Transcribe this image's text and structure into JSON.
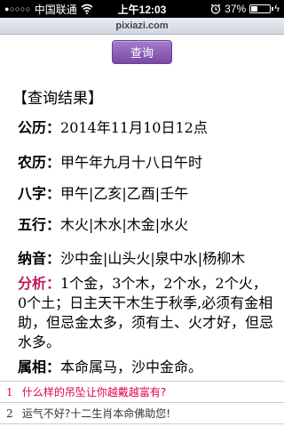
{
  "status_bar": {
    "signal": "●○○○○",
    "carrier": "中国联通",
    "time": "上午12:03",
    "battery_percent": 37,
    "battery_label": "37%"
  },
  "url_bar": {
    "domain": "pixiazi.com"
  },
  "query_button": {
    "label": "查询"
  },
  "results": {
    "header": "【查询结果】",
    "gongli": {
      "label": "公历：",
      "value": "2014年11月10日12点"
    },
    "nongli": {
      "label": "农历：",
      "value": "甲午年九月十八日午时"
    },
    "bazi": {
      "label": "八字：",
      "value": "甲午|乙亥|乙酉|壬午"
    },
    "wuxing": {
      "label": "五行：",
      "value": "木火|木水|木金|水火"
    },
    "nayin": {
      "label": "纳音：",
      "value": "沙中金|山头火|泉中水|杨柳木"
    },
    "fenxi": {
      "label": "分析：",
      "value": "1个金，3个木，2个水，2个火，0个土；日主天干木生于秋季,必须有金相助，但忌金太多，须有土、火才好，但忌水多。"
    },
    "shuxiang": {
      "label": "属相：",
      "value": "本命属马，沙中金命。"
    }
  },
  "links": [
    {
      "num": "1",
      "text": "什么样的吊坠让你越戴越富有?"
    },
    {
      "num": "2",
      "text": "运气不好?十二生肖本命佛助您!"
    }
  ],
  "colors": {
    "accent_purple": "#7a4aa7",
    "analysis_label": "#c2185b",
    "link_highlight": "#e5004f"
  }
}
